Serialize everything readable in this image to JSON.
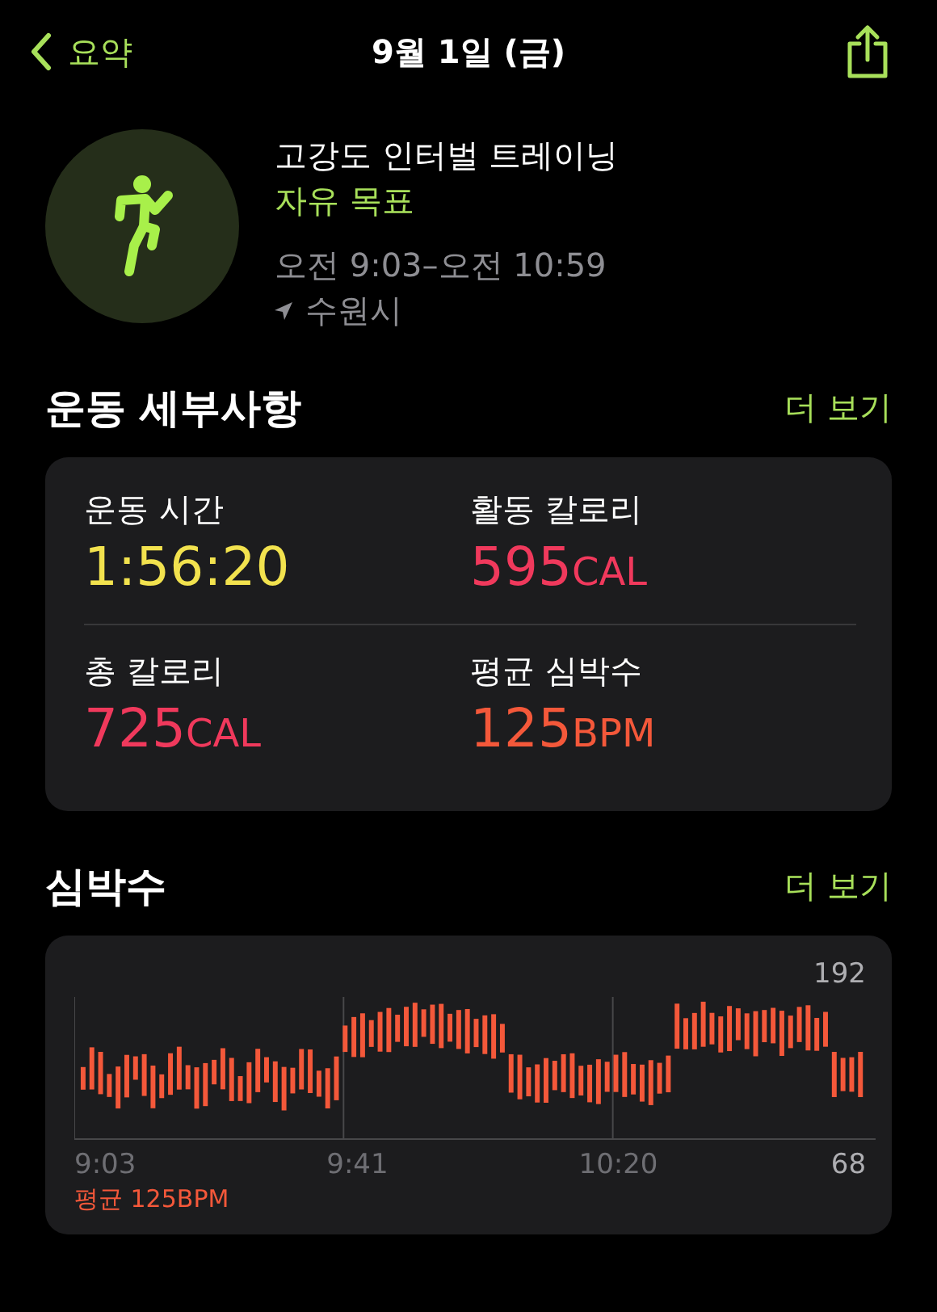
{
  "nav": {
    "back": "요약",
    "title": "9월 1일 (금)"
  },
  "workout": {
    "name": "고강도 인터벌 트레이닝",
    "goal": "자유 목표",
    "time": "오전 9:03–오전 10:59",
    "location": "수원시"
  },
  "details": {
    "title": "운동 세부사항",
    "more": "더 보기",
    "metrics": [
      {
        "label": "운동 시간",
        "value": "1:56:20",
        "color": "#f2e24e"
      },
      {
        "label": "활동 칼로리",
        "value": "595",
        "unit": "CAL",
        "color": "#f0395c"
      },
      {
        "label": "총 칼로리",
        "value": "725",
        "unit": "CAL",
        "color": "#f0395c"
      },
      {
        "label": "평균 심박수",
        "value": "125",
        "unit": "BPM",
        "color": "#f4583a"
      }
    ]
  },
  "heart_rate": {
    "title": "심박수",
    "more": "더 보기",
    "max": "192",
    "min": "68",
    "times": [
      "9:03",
      "9:41",
      "10:20"
    ],
    "average": "평균 125BPM"
  }
}
